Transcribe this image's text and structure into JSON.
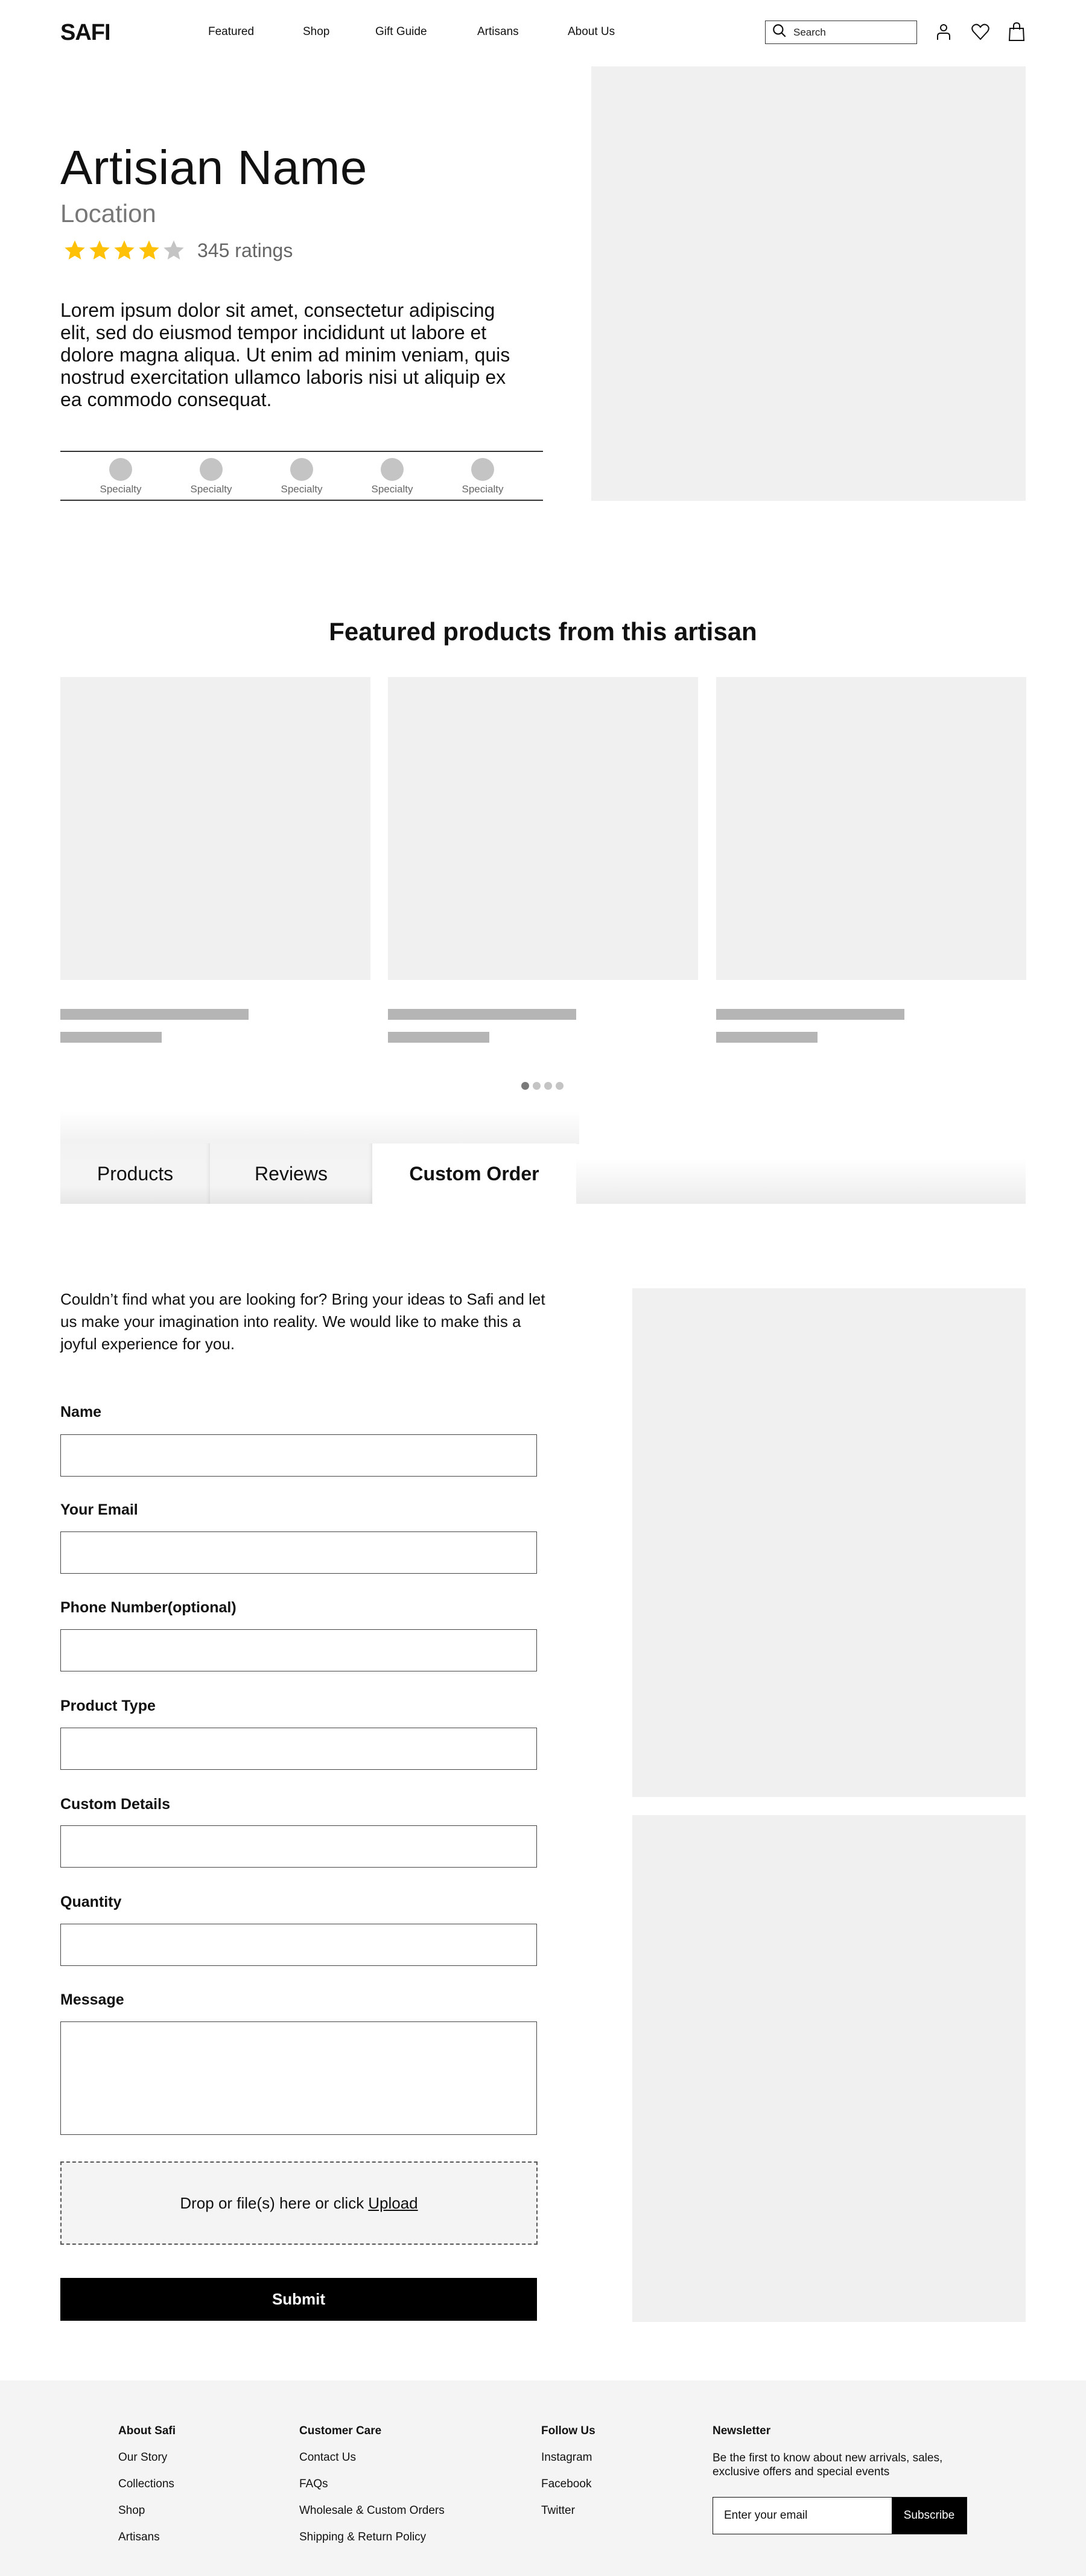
{
  "header": {
    "logo": "SAFI",
    "nav": [
      "Featured",
      "Shop",
      "Gift Guide",
      "Artisans",
      "About Us"
    ],
    "search_placeholder": "Search",
    "icons": [
      "account-icon",
      "wishlist-heart-icon",
      "shopping-bag-icon"
    ]
  },
  "artisan": {
    "name": "Artisian Name",
    "location": "Location",
    "rating": 4,
    "rating_max": 5,
    "ratings_count_label": "345 ratings",
    "description": "Lorem ipsum dolor sit amet, consectetur adipiscing elit, sed do eiusmod tempor incididunt ut labore et dolore magna aliqua. Ut enim ad minim veniam, quis nostrud exercitation ullamco laboris nisi ut aliquip ex ea commodo consequat.",
    "specialties": [
      "Specialty",
      "Specialty",
      "Specialty",
      "Specialty",
      "Specialty"
    ]
  },
  "featured": {
    "title": "Featured products from this artisan",
    "product_count": 3,
    "carousel_pages": 4,
    "carousel_active": 1
  },
  "tabs": {
    "items": [
      "Products",
      "Reviews",
      "Custom Order"
    ],
    "active": "Custom Order"
  },
  "custom_order": {
    "intro": "Couldn’t find what you are looking for? Bring your ideas to Safi and let us make your imagination into reality. We would like to make this a joyful experience for you.",
    "fields": [
      {
        "label": "Name",
        "value": ""
      },
      {
        "label": "Your Email",
        "value": ""
      },
      {
        "label": "Phone Number(optional)",
        "value": ""
      },
      {
        "label": "Product Type",
        "value": ""
      },
      {
        "label": "Custom Details",
        "value": ""
      },
      {
        "label": "Quantity",
        "value": ""
      }
    ],
    "message_label": "Message",
    "message_value": "",
    "dropzone_text": "Drop or file(s) here or click",
    "dropzone_link": "Upload",
    "submit_label": "Submit"
  },
  "footer": {
    "about": {
      "title": "About Safi",
      "links": [
        "Our Story",
        "Collections",
        "Shop",
        "Artisans"
      ]
    },
    "care": {
      "title": "Customer Care",
      "links": [
        "Contact Us",
        "FAQs",
        "Wholesale & Custom Orders",
        "Shipping & Return Policy"
      ]
    },
    "follow": {
      "title": "Follow Us",
      "links": [
        "Instagram",
        "Facebook",
        "Twitter"
      ]
    },
    "newsletter": {
      "title": "Newsletter",
      "description": "Be the first to know about new arrivals, sales, exclusive offers and special events",
      "email_placeholder": "Enter your email",
      "subscribe_label": "Subscribe"
    }
  },
  "colors": {
    "star_filled": "#FFC107",
    "star_empty": "#C4C4C4",
    "placeholder_bg": "#F0F0F0",
    "skeleton_bar": "#B5B5B5",
    "footer_bg": "#F4F4F4",
    "primary_button": "#000000"
  }
}
